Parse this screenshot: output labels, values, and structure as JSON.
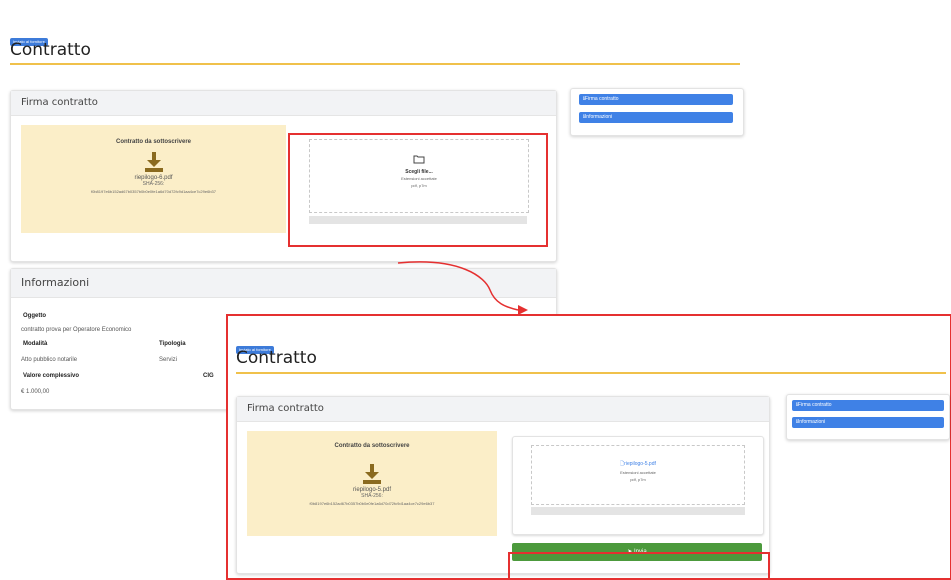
{
  "screen1": {
    "badge": "Inviato al fornitore",
    "page_title": "Contratto",
    "card1_title": "Firma contratto",
    "contract_box": {
      "title": "Contratto da sottoscrivere",
      "filename": "riepilogo-6.pdf",
      "sha_label": "SHA-256:",
      "hash": "f0b8197e6b152ad67b0357b0b0e0fe1a6d70d72fc9d1aa4ce7c29e6b37"
    },
    "upload": {
      "choose_label": "Scegli file...",
      "ext_label": "Estensioni accettate",
      "ext_value": "pdf, p7m"
    },
    "sidebar": [
      "Firma contratto",
      "Informazioni"
    ],
    "card2_title": "Informazioni",
    "info": {
      "oggetto_label": "Oggetto",
      "oggetto_value": "contratto prova per Operatore Economico",
      "modalita_label": "Modalità",
      "modalita_value": "Atto pubblico notarile",
      "tipologia_label": "Tipologia",
      "tipologia_value": "Servizi",
      "valore_label": "Valore complessivo",
      "valore_value": "€ 1.000,00",
      "cig_label": "CIG"
    }
  },
  "screen2": {
    "badge": "Inviato al fornitore",
    "page_title": "Contratto",
    "card1_title": "Firma contratto",
    "contract_box": {
      "title": "Contratto da sottoscrivere",
      "filename": "riepilogo-5.pdf",
      "sha_label": "SHA-256:",
      "hash": "f0b8197e6b152ad67b0357b0b0e0fe1a6d70d72fc9d1aa4ce7c29e6b37"
    },
    "upload": {
      "file_label": "riepilogo-5.pdf",
      "ext_label": "Estensioni accettate",
      "ext_value": "pdf, p7m"
    },
    "send_label": "Invia",
    "sidebar": [
      "Firma contratto",
      "Informazioni"
    ]
  },
  "colors": {
    "accent_rule": "#f0c14b",
    "sidebar_button": "#3f81e6",
    "send_button": "#4c9a3c",
    "highlight": "#e53030",
    "contract_box": "#fbeec8",
    "download_icon": "#8a6a1f"
  },
  "icons": [
    "folder-icon",
    "download-icon",
    "file-icon",
    "send-icon",
    "info-icon"
  ]
}
